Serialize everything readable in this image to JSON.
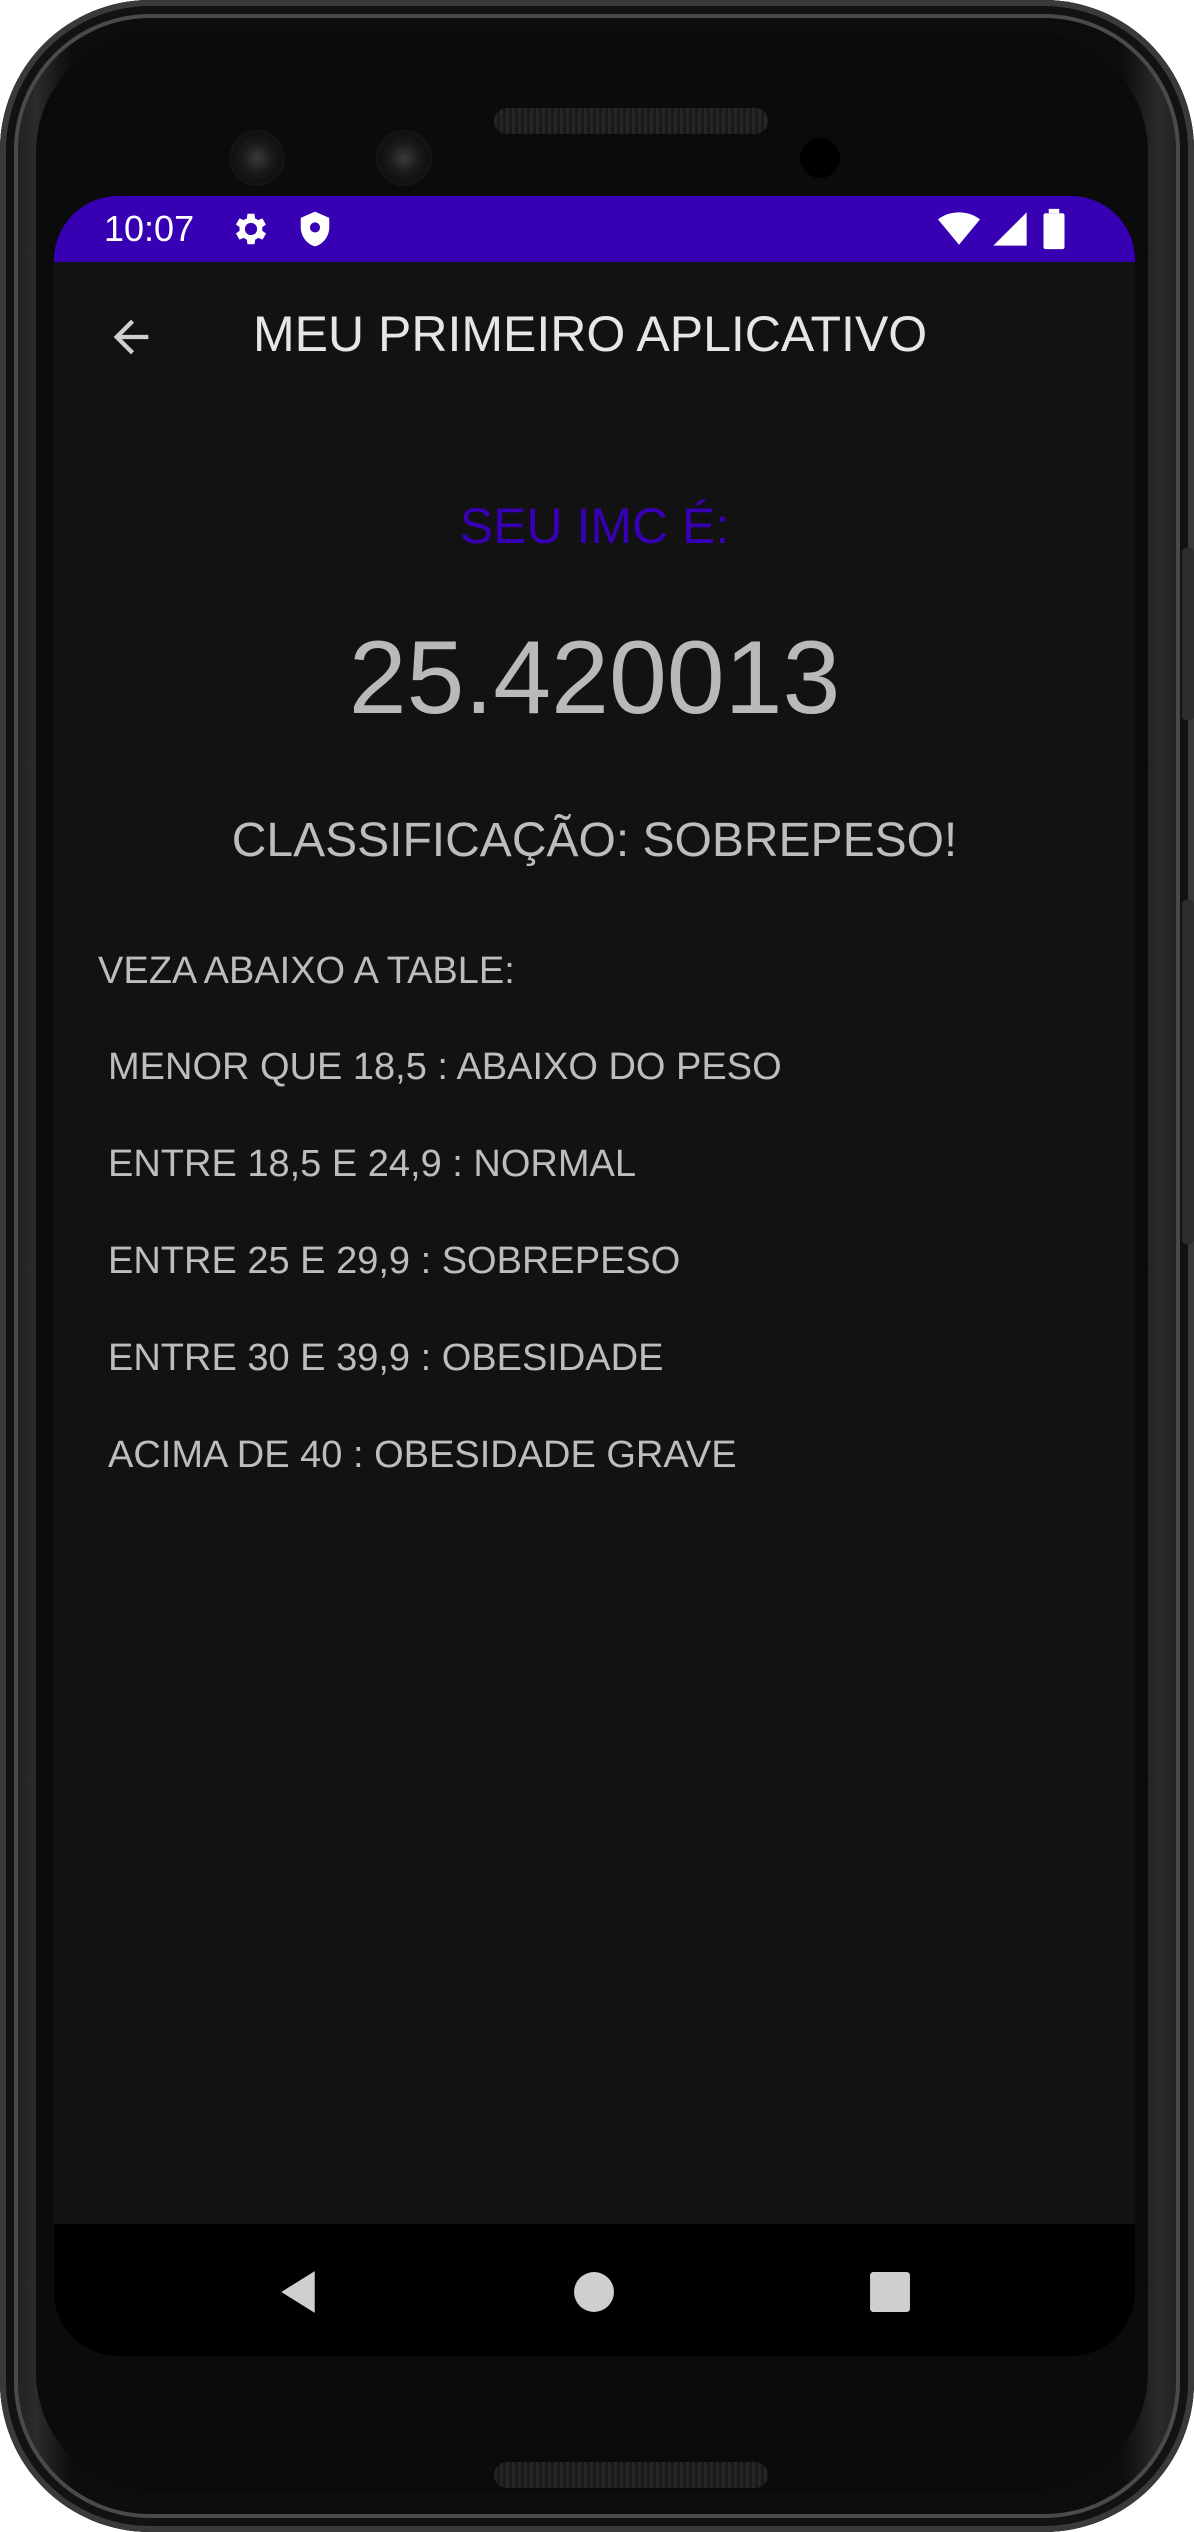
{
  "status_bar": {
    "time": "10:07",
    "icons": [
      "settings-gear-icon",
      "shield-icon",
      "wifi-icon",
      "cell-signal-icon",
      "battery-icon"
    ],
    "color": "#3700b3"
  },
  "app_bar": {
    "title": "MEU PRIMEIRO APLICATIVO",
    "back_icon": "arrow-back-icon"
  },
  "result": {
    "label": "SEU IMC É:",
    "value": "25.420013",
    "classification": "CLASSIFICAÇÃO: SOBREPESO!",
    "label_color": "#3700b3"
  },
  "table": {
    "title": "VEZA ABAIXO A TABLE:",
    "rows": [
      "MENOR QUE 18,5 : ABAIXO DO PESO",
      "ENTRE 18,5 E 24,9 : NORMAL",
      "ENTRE 25 E 29,9 : SOBREPESO",
      "ENTRE 30 E 39,9 : OBESIDADE",
      "ACIMA DE 40 : OBESIDADE GRAVE"
    ]
  },
  "nav_bar": {
    "buttons": [
      "nav-back-icon",
      "nav-home-icon",
      "nav-recents-icon"
    ]
  }
}
